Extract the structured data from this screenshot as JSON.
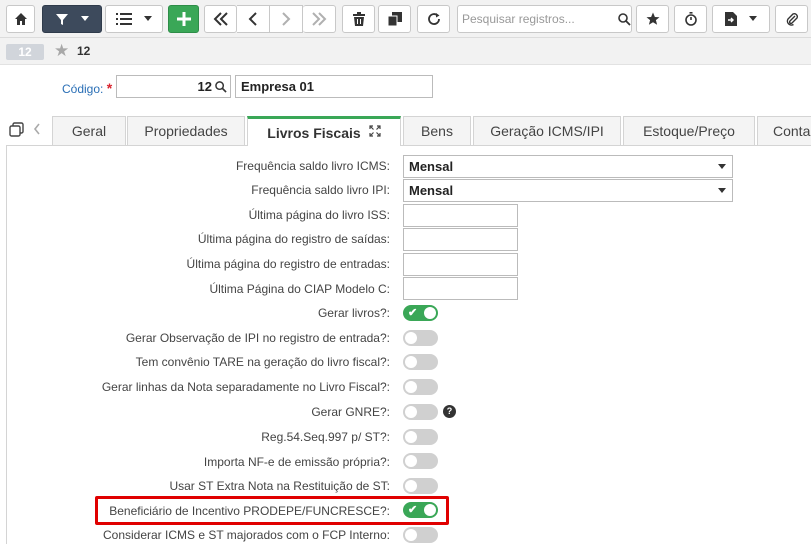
{
  "toolbar": {
    "search_placeholder": "Pesquisar registros..."
  },
  "record": {
    "badge": "12",
    "id": "12"
  },
  "codigo": {
    "label": "Código:",
    "required_mark": "*",
    "value": "12",
    "company": "Empresa 01"
  },
  "tabs": [
    {
      "label": "Geral"
    },
    {
      "label": "Propriedades"
    },
    {
      "label": "Livros Fiscais",
      "active": true
    },
    {
      "label": "Bens"
    },
    {
      "label": "Geração ICMS/IPI"
    },
    {
      "label": "Estoque/Preço"
    },
    {
      "label": "Conta"
    }
  ],
  "form": {
    "freq_icms": {
      "label": "Frequência saldo livro ICMS:",
      "value": "Mensal"
    },
    "freq_ipi": {
      "label": "Frequência saldo livro IPI:",
      "value": "Mensal"
    },
    "ult_iss": {
      "label": "Última página do livro ISS:",
      "value": ""
    },
    "ult_saidas": {
      "label": "Última página do registro de saídas:",
      "value": ""
    },
    "ult_entradas": {
      "label": "Última página do registro de entradas:",
      "value": ""
    },
    "ult_ciap": {
      "label": "Última Página do CIAP Modelo C:",
      "value": ""
    },
    "gerar_livros": {
      "label": "Gerar livros?:",
      "on": true
    },
    "gerar_obs_ipi": {
      "label": "Gerar Observação de IPI no registro de entrada?:",
      "on": false
    },
    "tare": {
      "label": "Tem convênio TARE na geração do livro fiscal?:",
      "on": false
    },
    "linhas_nota": {
      "label": "Gerar linhas da Nota separadamente no Livro Fiscal?:",
      "on": false
    },
    "gnre": {
      "label": "Gerar GNRE?:",
      "on": false
    },
    "reg54": {
      "label": "Reg.54.Seq.997 p/ ST?:",
      "on": false
    },
    "importa_nfe": {
      "label": "Importa NF-e de emissão própria?:",
      "on": false
    },
    "st_extra": {
      "label": "Usar ST Extra Nota na Restituição de ST:",
      "on": false
    },
    "prodepe": {
      "label": "Beneficiário de Incentivo PRODEPE/FUNCRESCE?:",
      "on": true
    },
    "fcp": {
      "label": "Considerar ICMS e ST majorados com o FCP Interno:",
      "on": false
    }
  },
  "colors": {
    "accent_green": "#3aa757",
    "dark_button": "#3d4a5c",
    "link_blue": "#2a6fb6",
    "highlight_red": "#e00000"
  }
}
